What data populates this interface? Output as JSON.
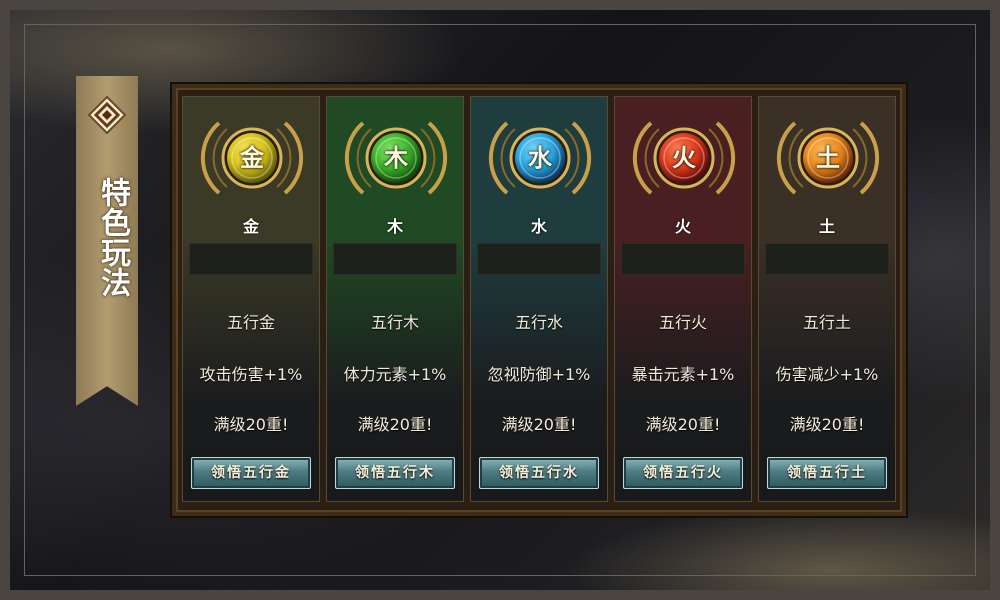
{
  "title": "特色玩法",
  "elements": [
    {
      "orb_char": "金",
      "label": "金",
      "name": "五行金",
      "effect": "攻击伤害+1%",
      "max": "满级20重!",
      "button": "领悟五行金",
      "orb_color": "#d8c21a",
      "orb_dark": "#5e5a0a",
      "glow": "#f7ea60",
      "card_top": "#3a3a26"
    },
    {
      "orb_char": "木",
      "label": "木",
      "name": "五行木",
      "effect": "体力元素+1%",
      "max": "满级20重!",
      "button": "领悟五行木",
      "orb_color": "#3db32a",
      "orb_dark": "#0f4a0a",
      "glow": "#8af070",
      "card_top": "#1f4a24"
    },
    {
      "orb_char": "水",
      "label": "水",
      "name": "五行水",
      "effect": "忽视防御+1%",
      "max": "满级20重!",
      "button": "领悟五行水",
      "orb_color": "#2aa6e0",
      "orb_dark": "#0a3a66",
      "glow": "#7fdcff",
      "card_top": "#1f3d3f"
    },
    {
      "orb_char": "火",
      "label": "火",
      "name": "五行火",
      "effect": "暴击元素+1%",
      "max": "满级20重!",
      "button": "领悟五行火",
      "orb_color": "#e03a1a",
      "orb_dark": "#5e0a0a",
      "glow": "#ff8a60",
      "card_top": "#4a1f22"
    },
    {
      "orb_char": "土",
      "label": "土",
      "name": "五行土",
      "effect": "伤害减少+1%",
      "max": "满级20重!",
      "button": "领悟五行土",
      "orb_color": "#e8861a",
      "orb_dark": "#6a2a06",
      "glow": "#ffc060",
      "card_top": "#3a3026"
    }
  ]
}
